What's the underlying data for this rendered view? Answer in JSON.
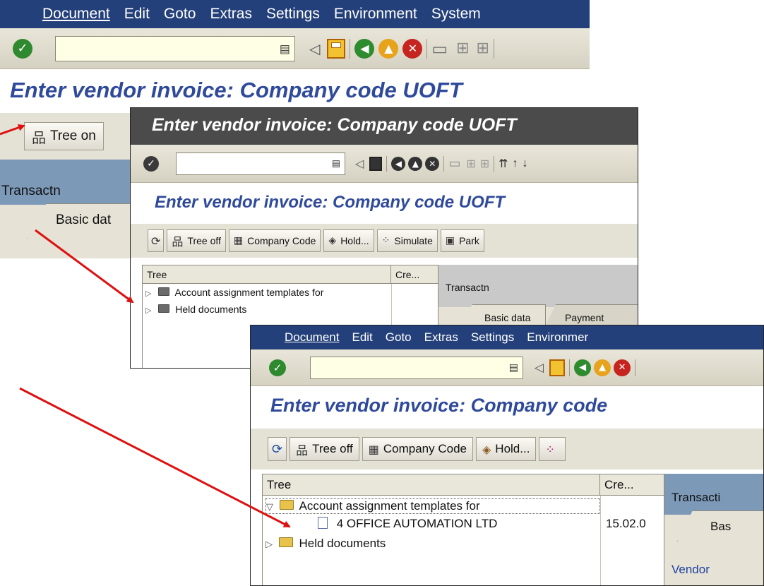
{
  "menu": [
    "Document",
    "Edit",
    "Goto",
    "Extras",
    "Settings",
    "Environment",
    "System"
  ],
  "menu_short": [
    "Document",
    "Edit",
    "Goto",
    "Extras",
    "Settings",
    "Environmer"
  ],
  "title": "Enter vendor invoice: Company code UOFT",
  "title_cut": "Enter vendor invoice: Company code",
  "bg": {
    "tree_on": "Tree on",
    "transactn": "Transactn",
    "tab_basic": "Basic dat"
  },
  "win2": {
    "titlebar": "Enter vendor invoice: Company code UOFT",
    "title": "Enter vendor invoice: Company code UOFT",
    "buttons": [
      "Tree off",
      "Company Code",
      "Hold...",
      "Simulate",
      "Park"
    ],
    "tree_col": "Tree",
    "cre_col": "Cre...",
    "nodes": [
      "Account assignment templates for",
      "Held documents"
    ],
    "transactn": "Transactn",
    "tab_basic": "Basic data",
    "tab_payment": "Payment"
  },
  "win3": {
    "title": "Enter vendor invoice: Company code",
    "buttons": [
      "Tree off",
      "Company Code",
      "Hold..."
    ],
    "tree_col": "Tree",
    "cre_col": "Cre...",
    "node_templates": "Account assignment templates for",
    "leaf_label": "4 OFFICE AUTOMATION LTD",
    "leaf_date": "15.02.0",
    "node_held": "Held documents",
    "transactn": "Transacti",
    "tab_bas": "Bas",
    "vendor": "Vendor"
  },
  "colors": {
    "menubar": "#24407a",
    "title": "#2f4a9b",
    "arrow": "#dd1111",
    "pane": "#7c99b8"
  }
}
